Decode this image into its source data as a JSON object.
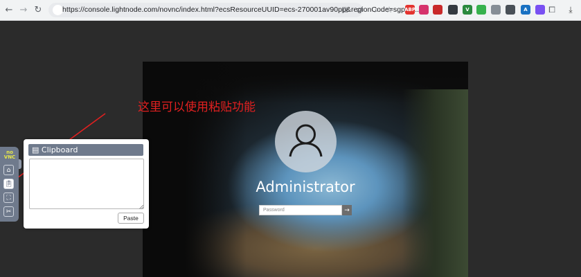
{
  "browser": {
    "url": "https://console.lightnode.com/novnc/index.html?ecsResourceUUID=ecs-270001av90pp&regionCode=sgp-si...",
    "extensions": [
      {
        "name": "abp-extension-icon",
        "label": "ABP",
        "color": "#e3342f"
      },
      {
        "name": "extension-pink-icon",
        "label": "",
        "color": "#d6336c"
      },
      {
        "name": "extension-red-icon",
        "label": "",
        "color": "#c92a2a"
      },
      {
        "name": "extension-palette-icon",
        "label": "",
        "color": "#343a40"
      },
      {
        "name": "extension-v-icon",
        "label": "V",
        "color": "#2b8a3e"
      },
      {
        "name": "extension-green-icon",
        "label": "",
        "color": "#37b24d"
      },
      {
        "name": "extension-camera-icon",
        "label": "",
        "color": "#868e96"
      },
      {
        "name": "extension-doc-icon",
        "label": "",
        "color": "#495057"
      },
      {
        "name": "extension-a-icon",
        "label": "A",
        "color": "#1971c2"
      },
      {
        "name": "extension-gemini-icon",
        "label": "",
        "color": "#7950f2"
      }
    ]
  },
  "remote": {
    "user_name": "Administrator",
    "password_placeholder": "Password"
  },
  "annotation": {
    "text": "这里可以使用粘贴功能",
    "color": "#e02020"
  },
  "vnc": {
    "logo_top": "no",
    "logo_bottom": "VNC"
  },
  "clipboard": {
    "title": "Clipboard",
    "content": "",
    "paste_label": "Paste"
  },
  "colors": {
    "panel_header": "#6f7a8c",
    "background": "#2b2b2b"
  }
}
